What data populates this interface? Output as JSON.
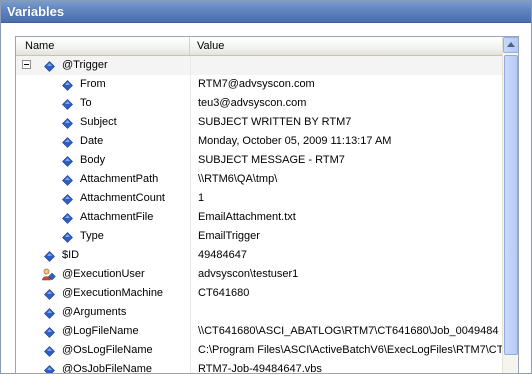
{
  "window": {
    "title": "Variables"
  },
  "columns": {
    "name": "Name",
    "value": "Value"
  },
  "rows": [
    {
      "name": "@Trigger",
      "value": "",
      "level": 0,
      "expandable": true,
      "icon": "diamond-icon"
    },
    {
      "name": "From",
      "value": "RTM7@advsyscon.com",
      "level": 1,
      "icon": "diamond-icon"
    },
    {
      "name": "To",
      "value": "teu3@advsyscon.com",
      "level": 1,
      "icon": "diamond-icon"
    },
    {
      "name": "Subject",
      "value": "SUBJECT WRITTEN BY RTM7",
      "level": 1,
      "icon": "diamond-icon"
    },
    {
      "name": "Date",
      "value": "Monday, October 05, 2009 11:13:17 AM",
      "level": 1,
      "icon": "diamond-icon"
    },
    {
      "name": "Body",
      "value": "SUBJECT MESSAGE - RTM7",
      "level": 1,
      "icon": "diamond-icon"
    },
    {
      "name": "AttachmentPath",
      "value": "\\\\RTM6\\QA\\tmp\\",
      "level": 1,
      "icon": "diamond-icon"
    },
    {
      "name": "AttachmentCount",
      "value": "1",
      "level": 1,
      "icon": "diamond-icon"
    },
    {
      "name": "AttachmentFile",
      "value": "EmailAttachment.txt",
      "level": 1,
      "icon": "diamond-icon"
    },
    {
      "name": "Type",
      "value": "EmailTrigger",
      "level": 1,
      "icon": "diamond-icon"
    },
    {
      "name": "$ID",
      "value": "49484647",
      "level": 0,
      "icon": "diamond-icon"
    },
    {
      "name": "@ExecutionUser",
      "value": "advsyscon\\testuser1",
      "level": 0,
      "icon": "user-icon"
    },
    {
      "name": "@ExecutionMachine",
      "value": "CT641680",
      "level": 0,
      "icon": "diamond-icon"
    },
    {
      "name": "@Arguments",
      "value": "",
      "level": 0,
      "icon": "diamond-icon"
    },
    {
      "name": "@LogFileName",
      "value": "\\\\CT641680\\ASCI_ABATLOG\\RTM7\\CT641680\\Job_0049484",
      "level": 0,
      "icon": "diamond-icon"
    },
    {
      "name": "@OsLogFileName",
      "value": "C:\\Program Files\\ASCI\\ActiveBatchV6\\ExecLogFiles\\RTM7\\CT",
      "level": 0,
      "icon": "diamond-icon"
    },
    {
      "name": "@OsJobFileName",
      "value": "RTM7-Job-49484647.vbs",
      "level": 0,
      "icon": "diamond-icon"
    }
  ],
  "scrollbar": {
    "position": 0.0
  },
  "colors": {
    "title_bar": "#5f83bf",
    "diamond": "#2f5fc4",
    "diamond_light": "#7fa6f0"
  }
}
